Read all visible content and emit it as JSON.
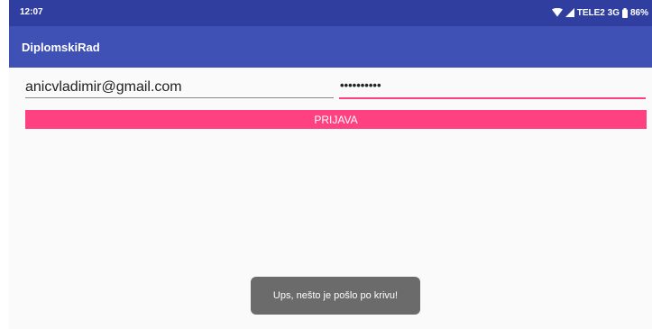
{
  "status_bar": {
    "time": "12:07",
    "carrier": "TELE2 3G",
    "battery": "86%",
    "icons": [
      "wifi-icon",
      "cellular-signal-icon",
      "battery-icon"
    ]
  },
  "app_bar": {
    "title": "DiplomskiRad"
  },
  "login_form": {
    "email_value": "anicvladimir@gmail.com",
    "password_value": "••••••••••",
    "login_label": "PRIJAVA"
  },
  "toast": {
    "message": "Ups, nešto je pošlo po krivu!"
  },
  "colors": {
    "primary": "#3f51b5",
    "primary_dark": "#303f9f",
    "accent": "#ff4081",
    "background": "#fafafa",
    "toast": "#6b6b6b"
  }
}
